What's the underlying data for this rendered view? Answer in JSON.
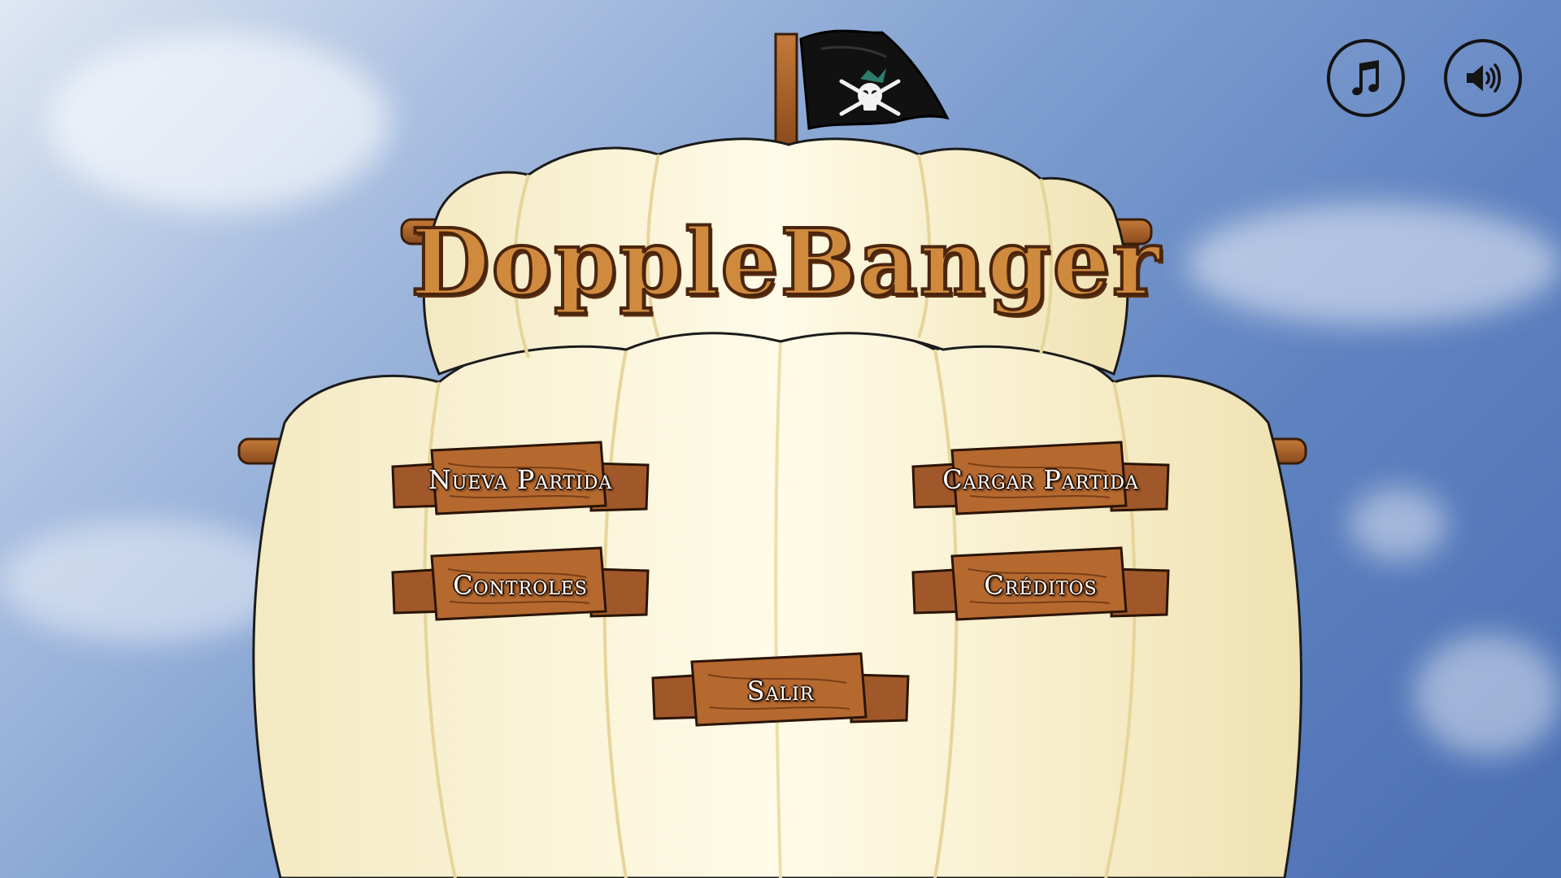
{
  "game": {
    "title": "DoppleBanger"
  },
  "toolbar": {
    "music_icon": "music-note-icon",
    "sound_icon": "speaker-volume-icon"
  },
  "menu": {
    "new_game": "Nueva Partida",
    "load_game": "Cargar Partida",
    "controls": "Controles",
    "credits": "Créditos",
    "exit": "Salir"
  },
  "colors": {
    "sky": "#5f82c0",
    "sail": "#fbf4d6",
    "wood": "#a8602a",
    "wood_dark": "#4a250d",
    "flag": "#111111"
  }
}
